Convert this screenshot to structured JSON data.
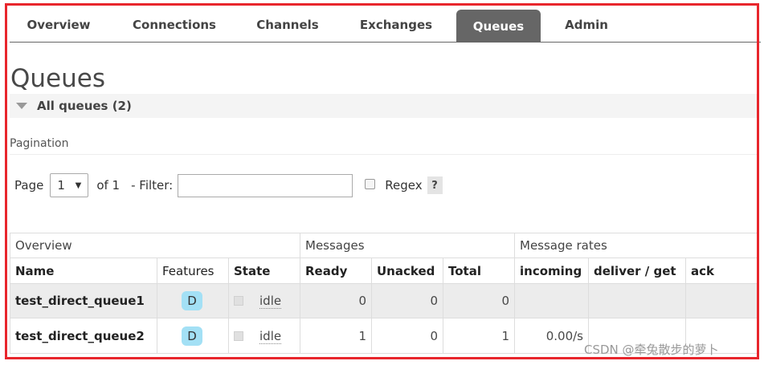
{
  "nav": {
    "tabs": [
      {
        "label": "Overview"
      },
      {
        "label": "Connections"
      },
      {
        "label": "Channels"
      },
      {
        "label": "Exchanges"
      },
      {
        "label": "Queues",
        "active": true
      },
      {
        "label": "Admin"
      }
    ]
  },
  "page": {
    "title": "Queues",
    "section_title": "All queues (2)"
  },
  "pagination": {
    "label": "Pagination",
    "page_label": "Page",
    "page_value": "1",
    "of_label": "of 1",
    "filter_label": "- Filter:",
    "filter_value": "",
    "regex_label": "Regex",
    "help_label": "?"
  },
  "table": {
    "groups": [
      "Overview",
      "Messages",
      "Message rates"
    ],
    "headers": [
      "Name",
      "Features",
      "State",
      "Ready",
      "Unacked",
      "Total",
      "incoming",
      "deliver / get",
      "ack"
    ],
    "rows": [
      {
        "name": "test_direct_queue1",
        "feature": "D",
        "state": "idle",
        "ready": "0",
        "unacked": "0",
        "total": "0",
        "incoming": "",
        "deliver_get": "",
        "ack": ""
      },
      {
        "name": "test_direct_queue2",
        "feature": "D",
        "state": "idle",
        "ready": "1",
        "unacked": "0",
        "total": "1",
        "incoming": "0.00/s",
        "deliver_get": "",
        "ack": ""
      }
    ]
  },
  "watermark": "CSDN @牵兔散步的萝卜",
  "colors": {
    "active_tab": "#666666",
    "feature_badge": "#a3e0f5",
    "highlight_frame": "#e8262c"
  }
}
